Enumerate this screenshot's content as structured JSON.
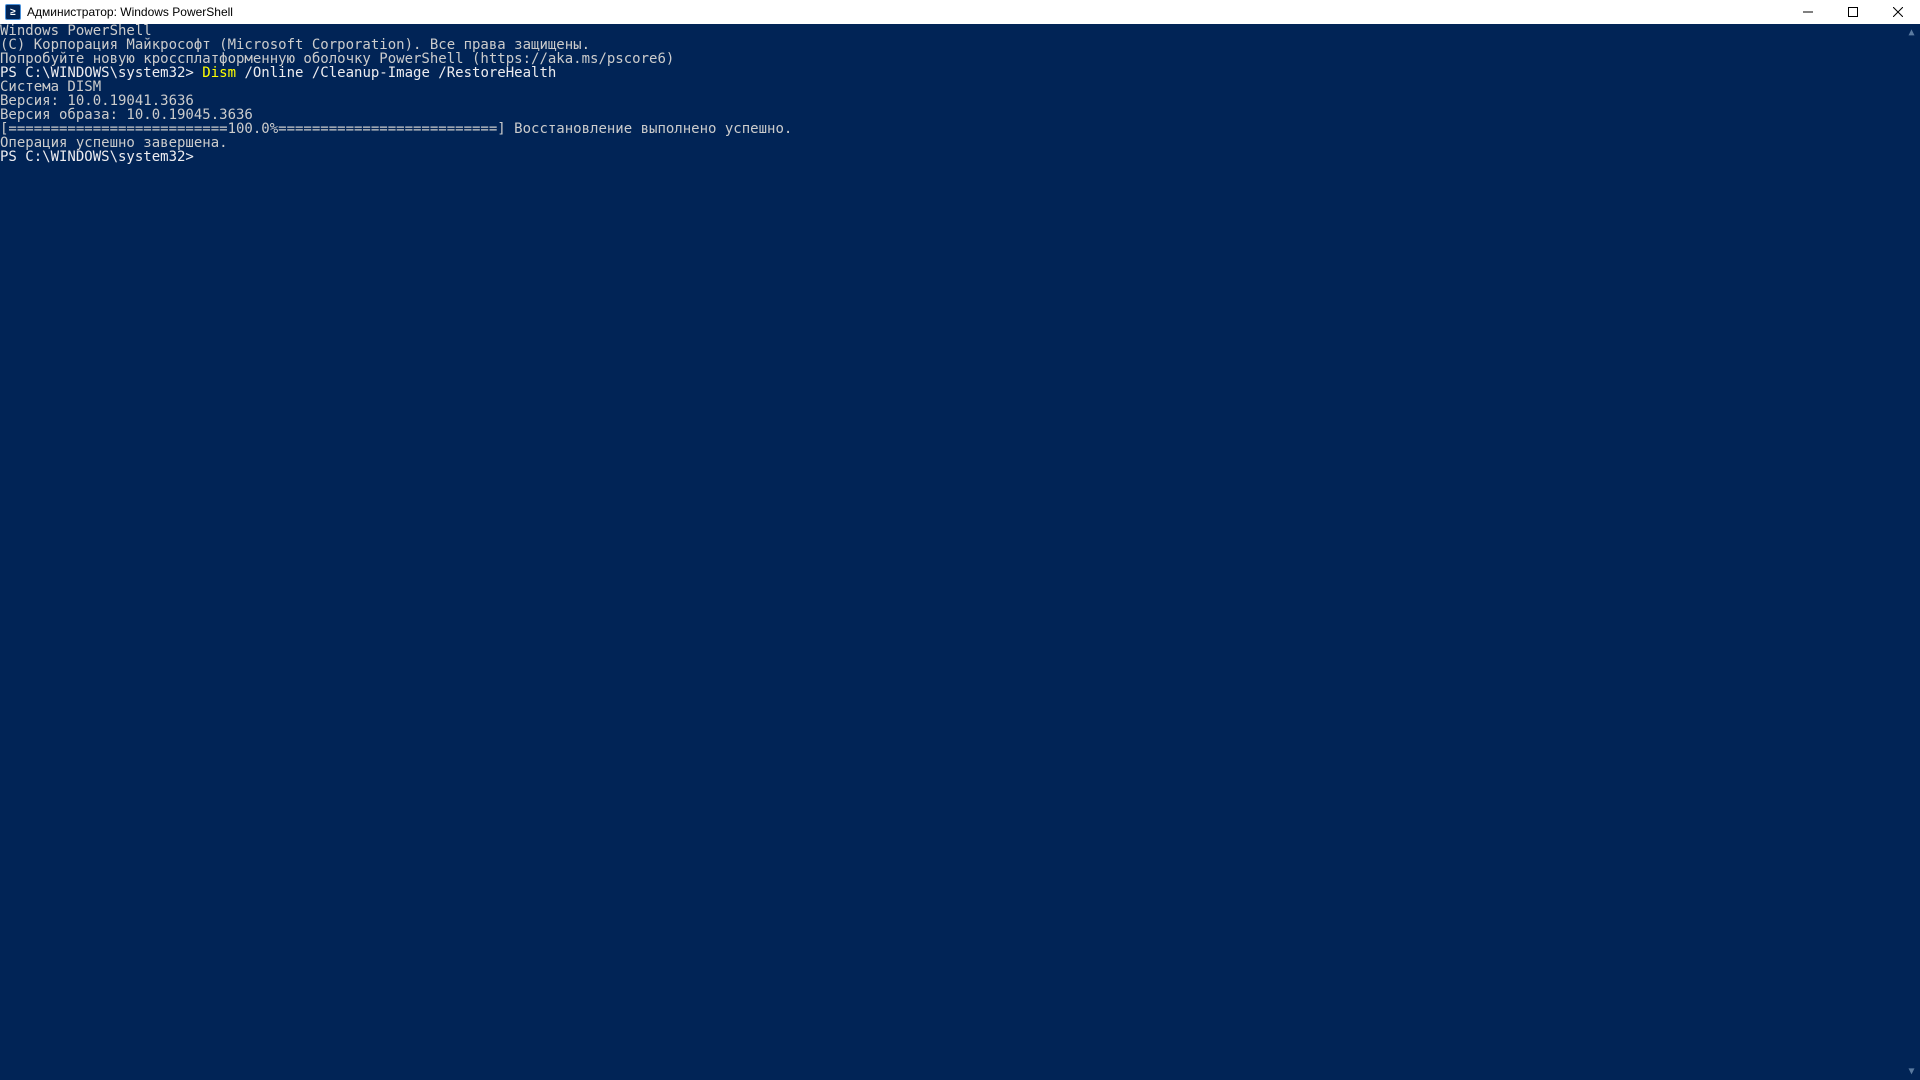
{
  "titlebar": {
    "title": "Администратор: Windows PowerShell",
    "icon_label": "powershell-icon",
    "icon_glyph": "≥"
  },
  "terminal": {
    "line1": "Windows PowerShell",
    "line2": "(C) Корпорация Майкрософт (Microsoft Corporation). Все права защищены.",
    "line3": "",
    "line4": "Попробуйте новую кроссплатформенную оболочку PowerShell (https://aka.ms/pscore6)",
    "line5": "",
    "prompt1": "PS C:\\WINDOWS\\system32> ",
    "cmd_name": "Dism",
    "cmd_args": " /Online /Cleanup-Image /RestoreHealth",
    "line7": "",
    "line8": "Cистема DISM",
    "line9": "Версия: 10.0.19041.3636",
    "line10": "",
    "line11": "Версия образа: 10.0.19045.3636",
    "line12": "",
    "progress": "[==========================100.0%==========================] Восстановление выполнено успешно.",
    "line14": "Операция успешно завершена.",
    "prompt2": "PS C:\\WINDOWS\\system32> "
  },
  "colors": {
    "background": "#012456",
    "text": "#cccccc",
    "cmd_highlight": "#ffff00"
  }
}
